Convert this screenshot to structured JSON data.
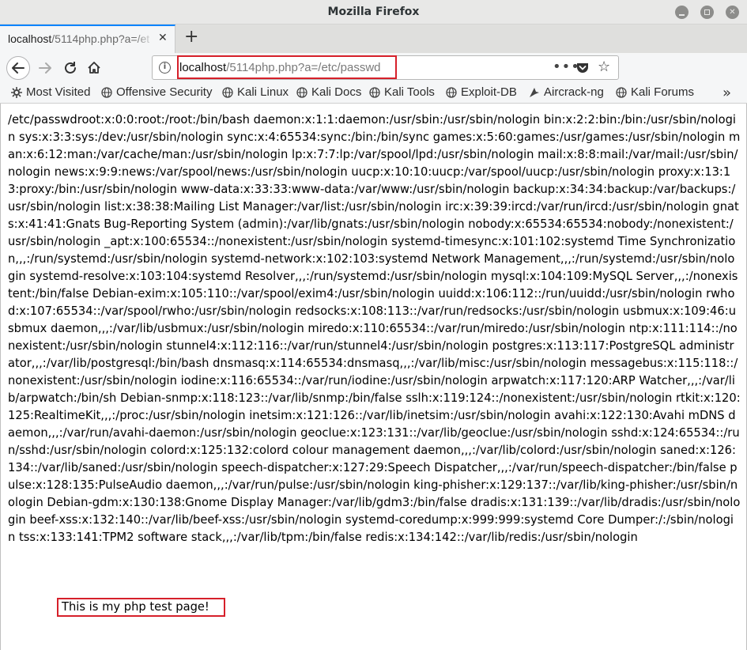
{
  "window": {
    "title": "Mozilla Firefox"
  },
  "tab": {
    "label_host": "localhost",
    "label_rest": "/5114php.php?a=/et"
  },
  "urlbar": {
    "host": "localhost",
    "path": "/5114php.php?a=/etc/passwd"
  },
  "bookmarks": [
    {
      "label": "Most Visited",
      "icon": "gear-icon"
    },
    {
      "label": "Offensive Security",
      "icon": "globe-icon"
    },
    {
      "label": "Kali Linux",
      "icon": "globe-icon"
    },
    {
      "label": "Kali Docs",
      "icon": "globe-icon"
    },
    {
      "label": "Kali Tools",
      "icon": "globe-icon"
    },
    {
      "label": "Exploit-DB",
      "icon": "globe-icon"
    },
    {
      "label": "Aircrack-ng",
      "icon": "aircrack-icon"
    },
    {
      "label": "Kali Forums",
      "icon": "globe-icon"
    }
  ],
  "page": {
    "passwd_text": "/etc/passwdroot:x:0:0:root:/root:/bin/bash daemon:x:1:1:daemon:/usr/sbin:/usr/sbin/nologin bin:x:2:2:bin:/bin:/usr/sbin/nologin sys:x:3:3:sys:/dev:/usr/sbin/nologin sync:x:4:65534:sync:/bin:/bin/sync games:x:5:60:games:/usr/games:/usr/sbin/nologin man:x:6:12:man:/var/cache/man:/usr/sbin/nologin lp:x:7:7:lp:/var/spool/lpd:/usr/sbin/nologin mail:x:8:8:mail:/var/mail:/usr/sbin/nologin news:x:9:9:news:/var/spool/news:/usr/sbin/nologin uucp:x:10:10:uucp:/var/spool/uucp:/usr/sbin/nologin proxy:x:13:13:proxy:/bin:/usr/sbin/nologin www-data:x:33:33:www-data:/var/www:/usr/sbin/nologin backup:x:34:34:backup:/var/backups:/usr/sbin/nologin list:x:38:38:Mailing List Manager:/var/list:/usr/sbin/nologin irc:x:39:39:ircd:/var/run/ircd:/usr/sbin/nologin gnats:x:41:41:Gnats Bug-Reporting System (admin):/var/lib/gnats:/usr/sbin/nologin nobody:x:65534:65534:nobody:/nonexistent:/usr/sbin/nologin _apt:x:100:65534::/nonexistent:/usr/sbin/nologin systemd-timesync:x:101:102:systemd Time Synchronization,,,:/run/systemd:/usr/sbin/nologin systemd-network:x:102:103:systemd Network Management,,,:/run/systemd:/usr/sbin/nologin systemd-resolve:x:103:104:systemd Resolver,,,:/run/systemd:/usr/sbin/nologin mysql:x:104:109:MySQL Server,,,:/nonexistent:/bin/false Debian-exim:x:105:110::/var/spool/exim4:/usr/sbin/nologin uuidd:x:106:112::/run/uuidd:/usr/sbin/nologin rwhod:x:107:65534::/var/spool/rwho:/usr/sbin/nologin redsocks:x:108:113::/var/run/redsocks:/usr/sbin/nologin usbmux:x:109:46:usbmux daemon,,,:/var/lib/usbmux:/usr/sbin/nologin miredo:x:110:65534::/var/run/miredo:/usr/sbin/nologin ntp:x:111:114::/nonexistent:/usr/sbin/nologin stunnel4:x:112:116::/var/run/stunnel4:/usr/sbin/nologin postgres:x:113:117:PostgreSQL administrator,,,:/var/lib/postgresql:/bin/bash dnsmasq:x:114:65534:dnsmasq,,,:/var/lib/misc:/usr/sbin/nologin messagebus:x:115:118::/nonexistent:/usr/sbin/nologin iodine:x:116:65534::/var/run/iodine:/usr/sbin/nologin arpwatch:x:117:120:ARP Watcher,,,:/var/lib/arpwatch:/bin/sh Debian-snmp:x:118:123::/var/lib/snmp:/bin/false sslh:x:119:124::/nonexistent:/usr/sbin/nologin rtkit:x:120:125:RealtimeKit,,,:/proc:/usr/sbin/nologin inetsim:x:121:126::/var/lib/inetsim:/usr/sbin/nologin avahi:x:122:130:Avahi mDNS daemon,,,:/var/run/avahi-daemon:/usr/sbin/nologin geoclue:x:123:131::/var/lib/geoclue:/usr/sbin/nologin sshd:x:124:65534::/run/sshd:/usr/sbin/nologin colord:x:125:132:colord colour management daemon,,,:/var/lib/colord:/usr/sbin/nologin saned:x:126:134::/var/lib/saned:/usr/sbin/nologin speech-dispatcher:x:127:29:Speech Dispatcher,,,:/var/run/speech-dispatcher:/bin/false pulse:x:128:135:PulseAudio daemon,,,:/var/run/pulse:/usr/sbin/nologin king-phisher:x:129:137::/var/lib/king-phisher:/usr/sbin/nologin Debian-gdm:x:130:138:Gnome Display Manager:/var/lib/gdm3:/bin/false dradis:x:131:139::/var/lib/dradis:/usr/sbin/nologin beef-xss:x:132:140::/var/lib/beef-xss:/usr/sbin/nologin systemd-coredump:x:999:999:systemd Core Dumper:/:/sbin/nologin tss:x:133:141:TPM2 software stack,,,:/var/lib/tpm:/bin/false redis:x:134:142::/var/lib/redis:/usr/sbin/nologin",
    "test_message": "This is my php test page!"
  },
  "colors": {
    "highlight": "#d6202a",
    "tab_accent": "#0a84ff"
  }
}
